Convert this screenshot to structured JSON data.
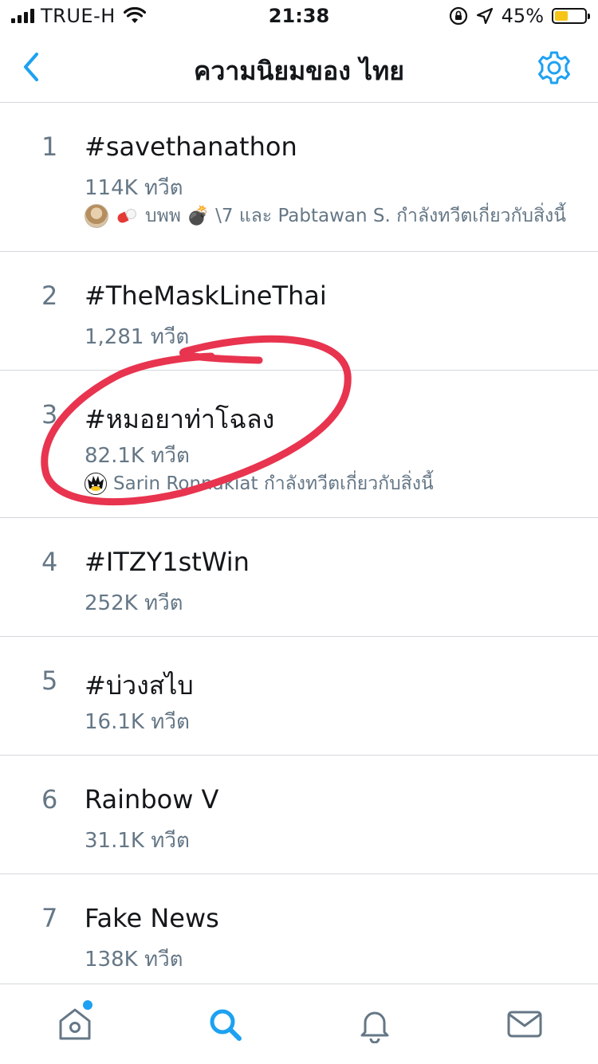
{
  "status_bar": {
    "carrier": "TRUE-H",
    "time": "21:38",
    "battery_percent": "45%",
    "battery_level": 0.45,
    "icons": [
      "signal-icon",
      "wifi-icon",
      "orientation-lock-icon",
      "location-arrow-icon",
      "battery-icon"
    ]
  },
  "nav": {
    "title": "ความนิยมของ ไทย",
    "back_icon": "chevron-left-icon",
    "settings_icon": "gear-icon"
  },
  "colors": {
    "accent": "#1da1f2",
    "text": "#14171a",
    "secondary": "#657786",
    "annotation": "#e8344f"
  },
  "trends": [
    {
      "rank": "1",
      "name": "#savethanathon",
      "count": "114K ทวีต",
      "context": "บพพ 💣 \\7 และ Pabtawan S. กำลังทวีตเกี่ยวกับสิ่งนี้"
    },
    {
      "rank": "2",
      "name": "#TheMaskLineThai",
      "count": "1,281 ทวีต"
    },
    {
      "rank": "3",
      "name": "#หมอยาท่าโฉลง",
      "count": "82.1K ทวีต",
      "context": "Sarin Ronnakiat กำลังทวีตเกี่ยวกับสิ่งนี้"
    },
    {
      "rank": "4",
      "name": "#ITZY1stWin",
      "count": "252K ทวีต"
    },
    {
      "rank": "5",
      "name": "#บ่วงสไบ",
      "count": "16.1K ทวีต"
    },
    {
      "rank": "6",
      "name": "Rainbow V",
      "count": "31.1K ทวีต"
    },
    {
      "rank": "7",
      "name": "Fake News",
      "count": "138K ทวีต"
    }
  ],
  "tab_bar": {
    "items": [
      "home-icon",
      "search-icon",
      "notifications-icon",
      "messages-icon"
    ],
    "active": "search-icon"
  }
}
